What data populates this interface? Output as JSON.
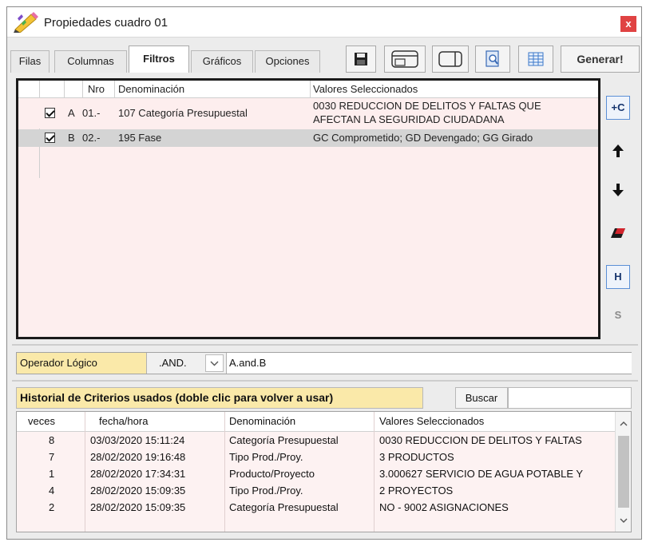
{
  "window": {
    "title": "Propiedades cuadro 01",
    "close_label": "x"
  },
  "tabs": [
    "Filas",
    "Columnas",
    "Filtros",
    "Gráficos",
    "Opciones"
  ],
  "active_tab": "Filtros",
  "toolbar": {
    "generate_label": "Generar!"
  },
  "filters": {
    "headers": {
      "nro": "Nro",
      "denominacion": "Denominación",
      "valores": "Valores Seleccionados"
    },
    "rows": [
      {
        "letter": "A",
        "nro": "01.-",
        "denominacion": "107 Categoría Presupuestal",
        "valores_line1": "0030 REDUCCION DE DELITOS Y FALTAS QUE",
        "valores_line2": "AFECTAN LA SEGURIDAD CIUDADANA",
        "checked": true
      },
      {
        "letter": "B",
        "nro": "02.-",
        "denominacion": "195 Fase",
        "valores_line1": "GC Comprometido; GD Devengado; GG Girado",
        "valores_line2": "",
        "checked": true
      }
    ]
  },
  "side_buttons": {
    "add_column": "+C",
    "h": "H",
    "s": "S"
  },
  "operator": {
    "label": "Operador Lógico",
    "value": ".AND.",
    "expression": "A.and.B"
  },
  "history": {
    "title": "Historial de Criterios usados  (doble clic para volver a usar)",
    "search_label": "Buscar",
    "headers": {
      "veces": "veces",
      "fecha": "fecha/hora",
      "denominacion": "Denominación",
      "valores": "Valores Seleccionados"
    },
    "rows": [
      {
        "veces": "8",
        "fecha": "03/03/2020 15:11:24",
        "denominacion": "Categoría Presupuestal",
        "valores": "0030 REDUCCION DE DELITOS Y FALTAS"
      },
      {
        "veces": "7",
        "fecha": "28/02/2020 19:16:48",
        "denominacion": "Tipo Prod./Proy.",
        "valores": "3 PRODUCTOS"
      },
      {
        "veces": "1",
        "fecha": "28/02/2020 17:34:31",
        "denominacion": "Producto/Proyecto",
        "valores": "3.000627 SERVICIO DE AGUA POTABLE Y"
      },
      {
        "veces": "4",
        "fecha": "28/02/2020 15:09:35",
        "denominacion": "Tipo Prod./Proy.",
        "valores": "2 PROYECTOS"
      },
      {
        "veces": "2",
        "fecha": "28/02/2020 15:09:35",
        "denominacion": "Categoría Presupuestal",
        "valores": "NO - 9002 ASIGNACIONES"
      }
    ]
  },
  "colors": {
    "accent_yellow": "#fae9a9",
    "row_pink": "#fdeeee",
    "selected_row": "#d4d4d4",
    "close_red": "#e04343"
  }
}
